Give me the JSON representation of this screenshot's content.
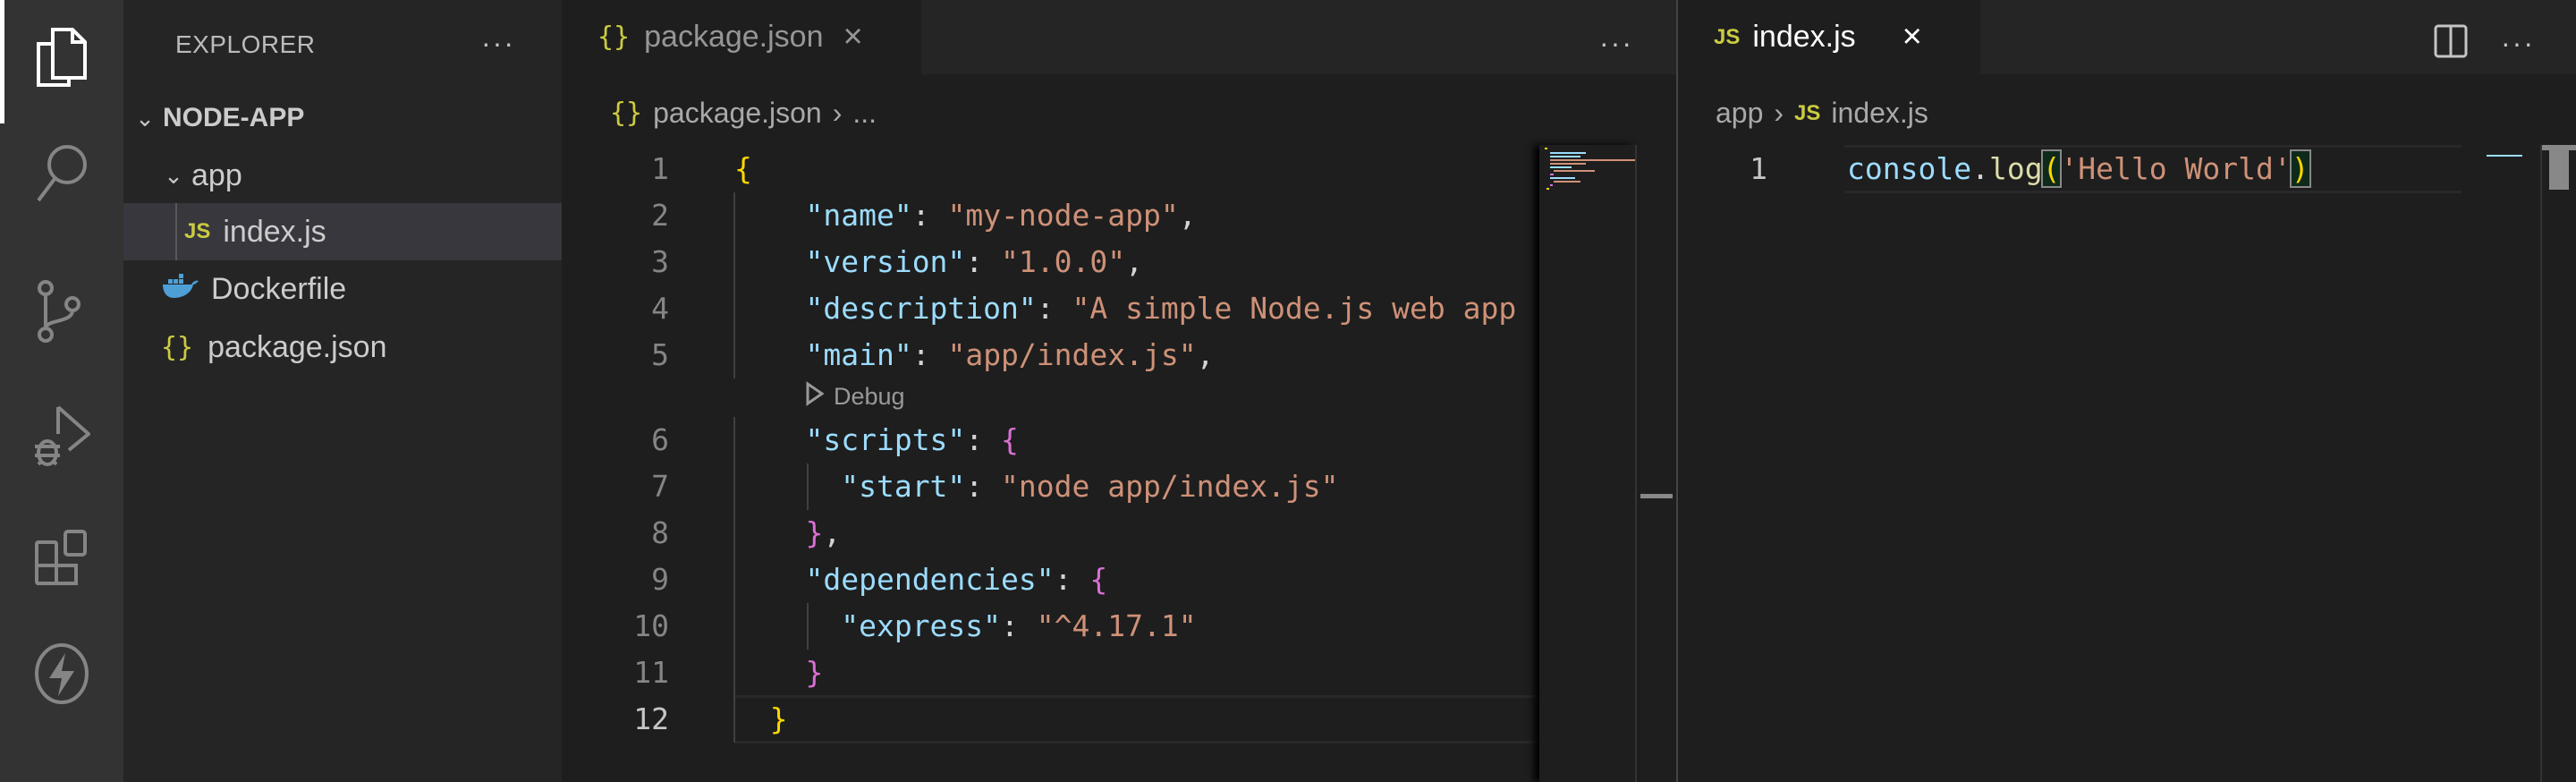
{
  "activity_bar": {
    "items": [
      "explorer",
      "search",
      "source-control",
      "run-and-debug",
      "extensions",
      "lightning"
    ]
  },
  "sidebar": {
    "title": "EXPLORER",
    "more": "···",
    "folder": "NODE-APP",
    "tree": [
      {
        "label": "app",
        "type": "folder",
        "depth": 1
      },
      {
        "label": "index.js",
        "type": "js",
        "depth": 2,
        "selected": true
      },
      {
        "label": "Dockerfile",
        "type": "docker",
        "depth": 1
      },
      {
        "label": "package.json",
        "type": "json",
        "depth": 1
      }
    ]
  },
  "left_editor": {
    "tab": {
      "icon": "{}",
      "label": "package.json",
      "close": "×"
    },
    "more": "···",
    "breadcrumb": {
      "icon": "{}",
      "file": "package.json",
      "sep": "›",
      "rest": "..."
    },
    "codelens": "Debug",
    "lines": [
      [
        [
          "b1",
          "{"
        ]
      ],
      [
        [
          "pun",
          "    "
        ],
        [
          "key",
          "\"name\""
        ],
        [
          "pun",
          ": "
        ],
        [
          "str",
          "\"my-node-app\""
        ],
        [
          "pun",
          ","
        ]
      ],
      [
        [
          "pun",
          "    "
        ],
        [
          "key",
          "\"version\""
        ],
        [
          "pun",
          ": "
        ],
        [
          "str",
          "\"1.0.0\""
        ],
        [
          "pun",
          ","
        ]
      ],
      [
        [
          "pun",
          "    "
        ],
        [
          "key",
          "\"description\""
        ],
        [
          "pun",
          ": "
        ],
        [
          "str",
          "\"A simple Node.js web app"
        ]
      ],
      [
        [
          "pun",
          "    "
        ],
        [
          "key",
          "\"main\""
        ],
        [
          "pun",
          ": "
        ],
        [
          "str",
          "\"app/index.js\""
        ],
        [
          "pun",
          ","
        ]
      ],
      [
        [
          "pun",
          "    "
        ],
        [
          "key",
          "\"scripts\""
        ],
        [
          "pun",
          ": "
        ],
        [
          "b2",
          "{"
        ]
      ],
      [
        [
          "pun",
          "      "
        ],
        [
          "key",
          "\"start\""
        ],
        [
          "pun",
          ": "
        ],
        [
          "str",
          "\"node app/index.js\""
        ]
      ],
      [
        [
          "pun",
          "    "
        ],
        [
          "b2",
          "}"
        ],
        [
          "pun",
          ","
        ]
      ],
      [
        [
          "pun",
          "    "
        ],
        [
          "key",
          "\"dependencies\""
        ],
        [
          "pun",
          ": "
        ],
        [
          "b2",
          "{"
        ]
      ],
      [
        [
          "pun",
          "      "
        ],
        [
          "key",
          "\"express\""
        ],
        [
          "pun",
          ": "
        ],
        [
          "str",
          "\"^4.17.1\""
        ]
      ],
      [
        [
          "pun",
          "    "
        ],
        [
          "b2",
          "}"
        ]
      ],
      [
        [
          "pun",
          "  "
        ],
        [
          "b1",
          "}"
        ]
      ]
    ],
    "active_line": 12
  },
  "right_editor": {
    "tab": {
      "icon": "JS",
      "label": "index.js",
      "close": "×"
    },
    "more": "···",
    "breadcrumb": {
      "folder": "app",
      "sep": "›",
      "icon": "JS",
      "file": "index.js"
    },
    "lines": [
      [
        [
          "var",
          "console"
        ],
        [
          "pun",
          "."
        ],
        [
          "fn",
          "log"
        ],
        [
          "b1",
          "("
        ],
        [
          "str",
          "'Hello World'"
        ],
        [
          "b1",
          ")"
        ]
      ]
    ],
    "active_line": 1
  },
  "colors": {
    "accent_json": "#cbcb41",
    "keys": "#9cdcfe",
    "strings": "#ce9178",
    "bracket1": "#ffd700",
    "bracket2": "#da70d6"
  }
}
